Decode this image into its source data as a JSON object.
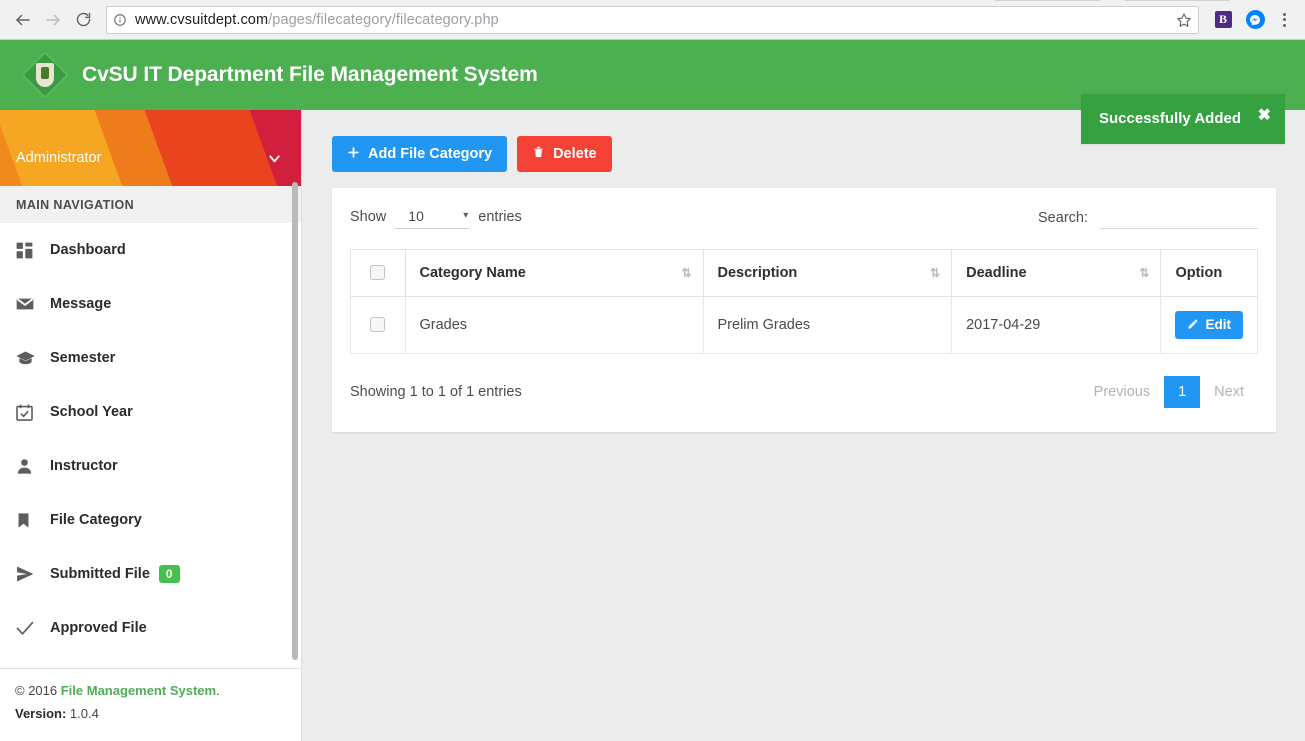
{
  "browser": {
    "back_icon": "back-arrow-icon",
    "forward_icon": "forward-arrow-icon",
    "reload_icon": "reload-icon",
    "info_icon": "info-circle-icon",
    "url_host": "www.cvsuitdept.com",
    "url_path": "/pages/filecategory/filecategory.php",
    "star_icon": "bookmark-star-icon",
    "extension_b_label": "B",
    "extension_messenger": "messenger-icon",
    "menu_icon": "three-dot-menu-icon"
  },
  "header": {
    "logo": "cvsu-seal-logo",
    "title": "CvSU IT Department File Management System",
    "toast": {
      "message": "Successfully Added",
      "close_label": "✖"
    },
    "brand_color": "#4caf50",
    "toast_color": "#35a141"
  },
  "sidebar": {
    "user": {
      "name": "Administrator",
      "caret_icon": "chevron-down-icon"
    },
    "nav_heading": "MAIN NAVIGATION",
    "items": [
      {
        "label": "Dashboard",
        "icon": "dashboard-grid-icon"
      },
      {
        "label": "Message",
        "icon": "envelope-icon"
      },
      {
        "label": "Semester",
        "icon": "graduation-cap-icon"
      },
      {
        "label": "School Year",
        "icon": "calendar-check-icon"
      },
      {
        "label": "Instructor",
        "icon": "person-icon"
      },
      {
        "label": "File Category",
        "icon": "bookmark-icon"
      },
      {
        "label": "Submitted File",
        "icon": "paper-plane-icon",
        "badge": "0"
      },
      {
        "label": "Approved File",
        "icon": "check-icon"
      }
    ],
    "badge_color": "#48c04f",
    "footer": {
      "copyright_prefix": "© 2016 ",
      "copyright_link": "File Management System",
      "copyright_suffix": ".",
      "version_label": "Version:",
      "version_value": "1.0.4"
    }
  },
  "content": {
    "buttons": {
      "add_label": "Add File Category",
      "add_icon": "plus-icon",
      "delete_label": "Delete",
      "delete_icon": "trash-icon"
    },
    "datatable": {
      "show_label": "Show",
      "length_value": "10",
      "length_caret": "▾",
      "entries_label": "entries",
      "search_label": "Search:",
      "search_value": "",
      "search_placeholder": "",
      "sort_icon": "⇅",
      "columns": [
        {
          "label": "",
          "sortable": false
        },
        {
          "label": "Category Name",
          "sortable": true
        },
        {
          "label": "Description",
          "sortable": true
        },
        {
          "label": "Deadline",
          "sortable": true
        },
        {
          "label": "Option",
          "sortable": false
        }
      ],
      "rows": [
        {
          "category_name": "Grades",
          "description": "Prelim Grades",
          "deadline": "2017-04-29",
          "edit_label": "Edit",
          "edit_icon": "pencil-icon"
        }
      ],
      "info_text": "Showing 1 to 1 of 1 entries",
      "pagination": {
        "previous": "Previous",
        "pages": [
          "1"
        ],
        "next": "Next",
        "active_page": "1"
      }
    }
  }
}
